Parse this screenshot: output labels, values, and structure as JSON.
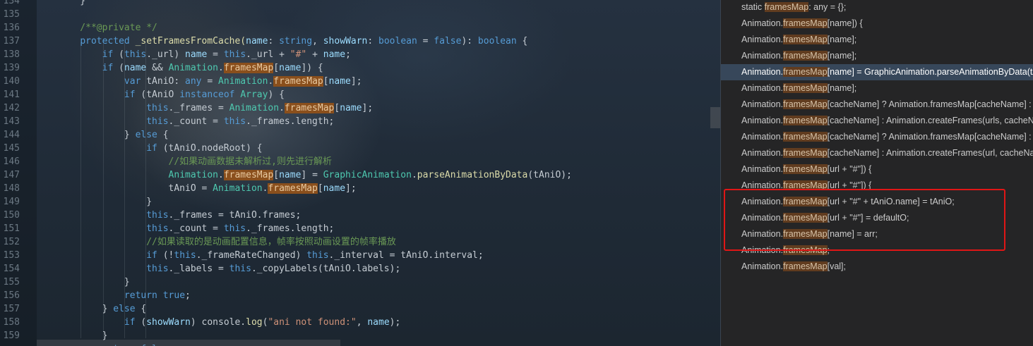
{
  "editor": {
    "line_numbers": [
      "134",
      "135",
      "136",
      "137",
      "138",
      "139",
      "140",
      "141",
      "142",
      "143",
      "144",
      "145",
      "146",
      "147",
      "148",
      "149",
      "150",
      "151",
      "152",
      "153",
      "154",
      "155",
      "156",
      "157",
      "158",
      "159"
    ],
    "lines": [
      [
        {
          "t": "    }",
          "c": ""
        }
      ],
      [
        {
          "t": "",
          "c": ""
        }
      ],
      [
        {
          "t": "    /**@private */",
          "c": "cm"
        }
      ],
      [
        {
          "t": "    ",
          "c": ""
        },
        {
          "t": "protected",
          "c": "kw"
        },
        {
          "t": " _setFramesFromCache(",
          "c": "fn"
        },
        {
          "t": "name",
          "c": "vr"
        },
        {
          "t": ": ",
          "c": ""
        },
        {
          "t": "string",
          "c": "kw"
        },
        {
          "t": ", ",
          "c": ""
        },
        {
          "t": "showWarn",
          "c": "vr"
        },
        {
          "t": ": ",
          "c": ""
        },
        {
          "t": "boolean",
          "c": "kw"
        },
        {
          "t": " = ",
          "c": ""
        },
        {
          "t": "false",
          "c": "kw"
        },
        {
          "t": "): ",
          "c": ""
        },
        {
          "t": "boolean",
          "c": "kw"
        },
        {
          "t": " {",
          "c": ""
        }
      ],
      [
        {
          "t": "        ",
          "c": ""
        },
        {
          "t": "if",
          "c": "kw"
        },
        {
          "t": " (",
          "c": ""
        },
        {
          "t": "this",
          "c": "kw"
        },
        {
          "t": "._url) ",
          "c": ""
        },
        {
          "t": "name",
          "c": "vr"
        },
        {
          "t": " = ",
          "c": ""
        },
        {
          "t": "this",
          "c": "kw"
        },
        {
          "t": "._url + ",
          "c": ""
        },
        {
          "t": "\"#\"",
          "c": "str"
        },
        {
          "t": " + ",
          "c": ""
        },
        {
          "t": "name",
          "c": "vr"
        },
        {
          "t": ";",
          "c": ""
        }
      ],
      [
        {
          "t": "        ",
          "c": ""
        },
        {
          "t": "if",
          "c": "kw"
        },
        {
          "t": " (",
          "c": ""
        },
        {
          "t": "name",
          "c": "vr"
        },
        {
          "t": " && ",
          "c": ""
        },
        {
          "t": "Animation",
          "c": "ty"
        },
        {
          "t": ".",
          "c": ""
        },
        {
          "t": "framesMap",
          "c": "hl"
        },
        {
          "t": "[",
          "c": ""
        },
        {
          "t": "name",
          "c": "vr"
        },
        {
          "t": "]) {",
          "c": ""
        }
      ],
      [
        {
          "t": "            ",
          "c": ""
        },
        {
          "t": "var",
          "c": "kw"
        },
        {
          "t": " tAniO: ",
          "c": ""
        },
        {
          "t": "any",
          "c": "kw"
        },
        {
          "t": " = ",
          "c": ""
        },
        {
          "t": "Animation",
          "c": "ty"
        },
        {
          "t": ".",
          "c": ""
        },
        {
          "t": "framesMap",
          "c": "hl"
        },
        {
          "t": "[",
          "c": ""
        },
        {
          "t": "name",
          "c": "vr"
        },
        {
          "t": "];",
          "c": ""
        }
      ],
      [
        {
          "t": "            ",
          "c": ""
        },
        {
          "t": "if",
          "c": "kw"
        },
        {
          "t": " (tAniO ",
          "c": ""
        },
        {
          "t": "instanceof",
          "c": "kw"
        },
        {
          "t": " ",
          "c": ""
        },
        {
          "t": "Array",
          "c": "ty"
        },
        {
          "t": ") {",
          "c": ""
        }
      ],
      [
        {
          "t": "                ",
          "c": ""
        },
        {
          "t": "this",
          "c": "kw"
        },
        {
          "t": "._frames = ",
          "c": ""
        },
        {
          "t": "Animation",
          "c": "ty"
        },
        {
          "t": ".",
          "c": ""
        },
        {
          "t": "framesMap",
          "c": "hl"
        },
        {
          "t": "[",
          "c": ""
        },
        {
          "t": "name",
          "c": "vr"
        },
        {
          "t": "];",
          "c": ""
        }
      ],
      [
        {
          "t": "                ",
          "c": ""
        },
        {
          "t": "this",
          "c": "kw"
        },
        {
          "t": "._count = ",
          "c": ""
        },
        {
          "t": "this",
          "c": "kw"
        },
        {
          "t": "._frames.length;",
          "c": ""
        }
      ],
      [
        {
          "t": "            } ",
          "c": ""
        },
        {
          "t": "else",
          "c": "kw"
        },
        {
          "t": " {",
          "c": ""
        }
      ],
      [
        {
          "t": "                ",
          "c": ""
        },
        {
          "t": "if",
          "c": "kw"
        },
        {
          "t": " (tAniO.nodeRoot) {",
          "c": ""
        }
      ],
      [
        {
          "t": "                    //如果动画数据未解析过,则先进行解析",
          "c": "cm"
        }
      ],
      [
        {
          "t": "                    ",
          "c": ""
        },
        {
          "t": "Animation",
          "c": "ty"
        },
        {
          "t": ".",
          "c": ""
        },
        {
          "t": "framesMap",
          "c": "hl"
        },
        {
          "t": "[",
          "c": ""
        },
        {
          "t": "name",
          "c": "vr"
        },
        {
          "t": "] = ",
          "c": ""
        },
        {
          "t": "GraphicAnimation",
          "c": "ty"
        },
        {
          "t": ".",
          "c": ""
        },
        {
          "t": "parseAnimationByData",
          "c": "fn"
        },
        {
          "t": "(tAniO);",
          "c": ""
        }
      ],
      [
        {
          "t": "                    tAniO = ",
          "c": ""
        },
        {
          "t": "Animation",
          "c": "ty"
        },
        {
          "t": ".",
          "c": ""
        },
        {
          "t": "framesMap",
          "c": "hl"
        },
        {
          "t": "[",
          "c": ""
        },
        {
          "t": "name",
          "c": "vr"
        },
        {
          "t": "];",
          "c": ""
        }
      ],
      [
        {
          "t": "                }",
          "c": ""
        }
      ],
      [
        {
          "t": "                ",
          "c": ""
        },
        {
          "t": "this",
          "c": "kw"
        },
        {
          "t": "._frames = tAniO.frames;",
          "c": ""
        }
      ],
      [
        {
          "t": "                ",
          "c": ""
        },
        {
          "t": "this",
          "c": "kw"
        },
        {
          "t": "._count = ",
          "c": ""
        },
        {
          "t": "this",
          "c": "kw"
        },
        {
          "t": "._frames.length;",
          "c": ""
        }
      ],
      [
        {
          "t": "                //如果读取的是动画配置信息，帧率按照动画设置的帧率播放",
          "c": "cm"
        }
      ],
      [
        {
          "t": "                ",
          "c": ""
        },
        {
          "t": "if",
          "c": "kw"
        },
        {
          "t": " (!",
          "c": ""
        },
        {
          "t": "this",
          "c": "kw"
        },
        {
          "t": "._frameRateChanged) ",
          "c": ""
        },
        {
          "t": "this",
          "c": "kw"
        },
        {
          "t": "._interval = tAniO.interval;",
          "c": ""
        }
      ],
      [
        {
          "t": "                ",
          "c": ""
        },
        {
          "t": "this",
          "c": "kw"
        },
        {
          "t": "._labels = ",
          "c": ""
        },
        {
          "t": "this",
          "c": "kw"
        },
        {
          "t": "._copyLabels(tAniO.labels);",
          "c": ""
        }
      ],
      [
        {
          "t": "            }",
          "c": ""
        }
      ],
      [
        {
          "t": "            ",
          "c": ""
        },
        {
          "t": "return",
          "c": "kw"
        },
        {
          "t": " ",
          "c": ""
        },
        {
          "t": "true",
          "c": "kw"
        },
        {
          "t": ";",
          "c": ""
        }
      ],
      [
        {
          "t": "        } ",
          "c": ""
        },
        {
          "t": "else",
          "c": "kw"
        },
        {
          "t": " {",
          "c": ""
        }
      ],
      [
        {
          "t": "            ",
          "c": ""
        },
        {
          "t": "if",
          "c": "kw"
        },
        {
          "t": " (",
          "c": ""
        },
        {
          "t": "showWarn",
          "c": "vr"
        },
        {
          "t": ") console.",
          "c": ""
        },
        {
          "t": "log",
          "c": "fn"
        },
        {
          "t": "(",
          "c": ""
        },
        {
          "t": "\"ani not found:\"",
          "c": "str"
        },
        {
          "t": ", ",
          "c": ""
        },
        {
          "t": "name",
          "c": "vr"
        },
        {
          "t": ");",
          "c": ""
        }
      ],
      [
        {
          "t": "        }",
          "c": ""
        }
      ],
      [
        {
          "t": "        ",
          "c": ""
        },
        {
          "t": "return",
          "c": "kw"
        },
        {
          "t": " ",
          "c": ""
        },
        {
          "t": "false",
          "c": "kw"
        },
        {
          "t": ";",
          "c": ""
        }
      ]
    ]
  },
  "references_panel": {
    "selected_index": 4,
    "items": [
      [
        {
          "t": "static ",
          "c": ""
        },
        {
          "t": "framesMap",
          "c": "fm"
        },
        {
          "t": ": any = {};",
          "c": ""
        }
      ],
      [
        {
          "t": "Animation.",
          "c": ""
        },
        {
          "t": "framesMap",
          "c": "fm"
        },
        {
          "t": "[name]) {",
          "c": ""
        }
      ],
      [
        {
          "t": "Animation.",
          "c": ""
        },
        {
          "t": "framesMap",
          "c": "fm"
        },
        {
          "t": "[name];",
          "c": ""
        }
      ],
      [
        {
          "t": "Animation.",
          "c": ""
        },
        {
          "t": "framesMap",
          "c": "fm"
        },
        {
          "t": "[name];",
          "c": ""
        }
      ],
      [
        {
          "t": "Animation.",
          "c": ""
        },
        {
          "t": "framesMap",
          "c": "fm"
        },
        {
          "t": "[name] = GraphicAnimation.parseAnimationByData(tAniO);",
          "c": ""
        }
      ],
      [
        {
          "t": "Animation.",
          "c": ""
        },
        {
          "t": "framesMap",
          "c": "fm"
        },
        {
          "t": "[name];",
          "c": ""
        }
      ],
      [
        {
          "t": "Animation.",
          "c": ""
        },
        {
          "t": "framesMap",
          "c": "fm"
        },
        {
          "t": "[cacheName] ? Animation.framesMap[cacheName] : null;",
          "c": ""
        }
      ],
      [
        {
          "t": "Animation.",
          "c": ""
        },
        {
          "t": "framesMap",
          "c": "fm"
        },
        {
          "t": "[cacheName] : Animation.createFrames(urls, cacheName);",
          "c": ""
        }
      ],
      [
        {
          "t": "Animation.",
          "c": ""
        },
        {
          "t": "framesMap",
          "c": "fm"
        },
        {
          "t": "[cacheName] ? Animation.framesMap[cacheName] : null;",
          "c": ""
        }
      ],
      [
        {
          "t": "Animation.",
          "c": ""
        },
        {
          "t": "framesMap",
          "c": "fm"
        },
        {
          "t": "[cacheName] : Animation.createFrames(url, cacheName);",
          "c": ""
        }
      ],
      [
        {
          "t": "Animation.",
          "c": ""
        },
        {
          "t": "framesMap",
          "c": "fm"
        },
        {
          "t": "[url + \"#\"]) {",
          "c": ""
        }
      ],
      [
        {
          "t": "Animation.",
          "c": ""
        },
        {
          "t": "framesMap",
          "c": "fm"
        },
        {
          "t": "[url + \"#\"]) {",
          "c": ""
        }
      ],
      [
        {
          "t": "Animation.",
          "c": ""
        },
        {
          "t": "framesMap",
          "c": "fm"
        },
        {
          "t": "[url + \"#\" + tAniO.name] = tAniO;",
          "c": ""
        }
      ],
      [
        {
          "t": "Animation.",
          "c": ""
        },
        {
          "t": "framesMap",
          "c": "fm"
        },
        {
          "t": "[url + \"#\"] = defaultO;",
          "c": ""
        }
      ],
      [
        {
          "t": "Animation.",
          "c": ""
        },
        {
          "t": "framesMap",
          "c": "fm"
        },
        {
          "t": "[name] = arr;",
          "c": ""
        }
      ],
      [
        {
          "t": "Animation.",
          "c": ""
        },
        {
          "t": "framesMap",
          "c": "fm"
        },
        {
          "t": ";",
          "c": ""
        }
      ],
      [
        {
          "t": "Animation.",
          "c": ""
        },
        {
          "t": "framesMap",
          "c": "fm"
        },
        {
          "t": "[val];",
          "c": ""
        }
      ]
    ]
  },
  "colors": {
    "highlight": "#8a4f1c",
    "annotation_box": "#e01616",
    "panel_selection": "#37475a"
  }
}
